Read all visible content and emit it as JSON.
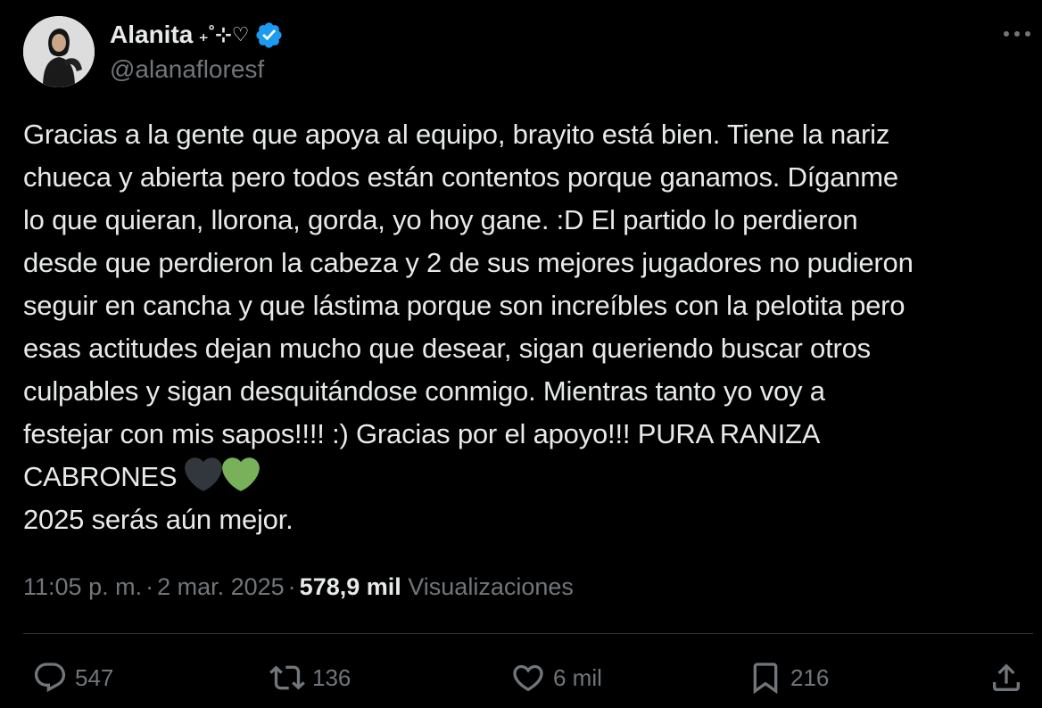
{
  "author": {
    "display_name": "Alanita",
    "name_decoration": "₊˚⊹♡",
    "handle": "@alanafloresf",
    "verified": true
  },
  "tweet": {
    "lines": [
      "Gracias a la gente que apoya al equipo, brayito está bien. Tiene la nariz",
      "chueca y abierta pero todos están contentos porque ganamos. Díganme",
      "lo que quieran, llorona, gorda, yo hoy gane. :D El partido lo perdieron",
      "desde que perdieron la cabeza y 2 de sus mejores jugadores no pudieron",
      "seguir en cancha y que lástima porque son increíbles con la pelotita pero",
      "esas actitudes dejan mucho que desear, sigan queriendo buscar otros",
      "culpables y sigan desquitándose conmigo. Mientras tanto yo voy a",
      "festejar con mis sapos!!!! :) Gracias por el apoyo!!! PURA RANIZA",
      "CABRONES",
      "2025 serás aún mejor."
    ],
    "emojis": [
      "black-heart",
      "green-heart"
    ]
  },
  "meta": {
    "time": "11:05 p. m.",
    "date": "2 mar. 2025",
    "separator": "·",
    "views_count": "578,9 mil",
    "views_label": "Visualizaciones"
  },
  "actions": {
    "replies": "547",
    "reposts": "136",
    "likes": "6 mil",
    "bookmarks": "216"
  },
  "colors": {
    "background": "#000000",
    "text": "#e7e9ea",
    "muted": "#71767b",
    "verified": "#1d9bf0",
    "green_heart": "#78b159",
    "black_heart": "#31373d"
  }
}
